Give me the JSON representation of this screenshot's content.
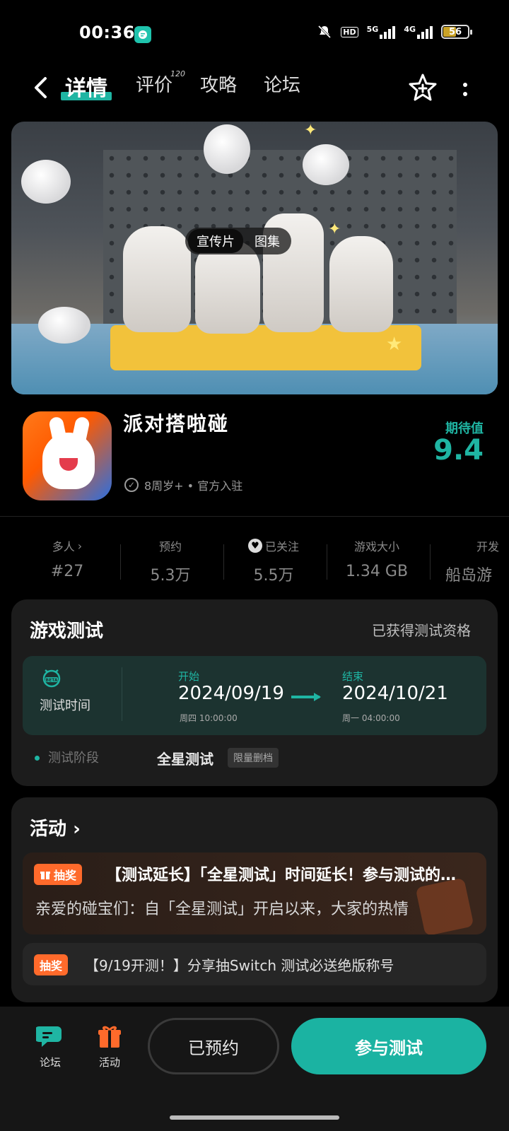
{
  "status_bar": {
    "time": "00:36",
    "network_5g": "5G",
    "network_4g": "4G",
    "battery": "56",
    "hd": "HD"
  },
  "nav": {
    "tab_details": "详情",
    "tab_reviews": "评价",
    "review_count": "120",
    "tab_guides": "攻略",
    "tab_forum": "论坛"
  },
  "media": {
    "trailer": "宣传片",
    "gallery": "图集"
  },
  "game": {
    "title": "派对搭啦碰",
    "tags": "8周岁+ • 官方入驻",
    "expect_label": "期待值",
    "expect_score": "9.4"
  },
  "stats": [
    {
      "label": "多人",
      "value": "#27"
    },
    {
      "label": "预约",
      "value": "5.3万"
    },
    {
      "label": "已关注",
      "value": "5.5万"
    },
    {
      "label": "游戏大小",
      "value": "1.34 GB"
    },
    {
      "label": "开发",
      "value": "船岛游"
    }
  ],
  "test": {
    "title": "游戏测试",
    "qualified": "已获得测试资格",
    "time_label": "测试时间",
    "start_label": "开始",
    "start_date": "2024/09/19",
    "start_sub": "周四 10:00:00",
    "end_label": "结束",
    "end_date": "2024/10/21",
    "end_sub": "周一 04:00:00",
    "stage_label": "测试阶段",
    "stage_value": "全星测试",
    "stage_badge": "限量删档"
  },
  "activity": {
    "title": "活动",
    "items": [
      {
        "badge": "抽奖",
        "title": "【测试延长】「全星测试」时间延长！参与测试的碰宝们",
        "desc": "亲爱的碰宝们：自「全星测试」开启以来，大家的热情"
      },
      {
        "badge": "抽奖",
        "title": "【9/19开测！】分享抽Switch 测试必送绝版称号"
      }
    ]
  },
  "bottom": {
    "forum": "论坛",
    "activity": "活动",
    "reserved": "已预约",
    "join": "参与测试"
  },
  "icons": [
    "back-icon",
    "star-plus-icon",
    "more-icon",
    "check-circle-icon",
    "heart-icon",
    "beta-alarm-icon",
    "gift-icon",
    "forum-icon"
  ],
  "colors": {
    "accent": "#1fb5a3",
    "lottery": "#ff6a2b",
    "background": "#000000",
    "card": "#1c1c1c"
  }
}
